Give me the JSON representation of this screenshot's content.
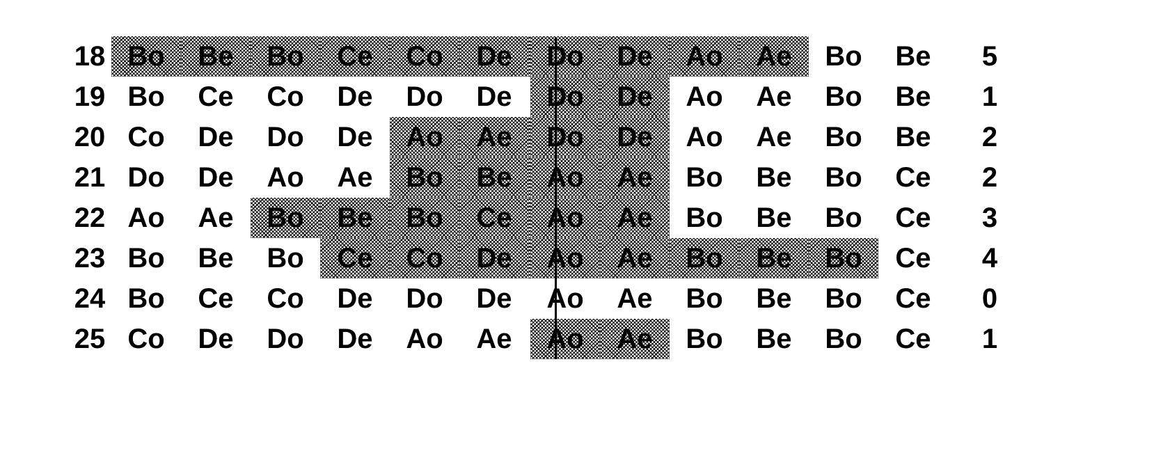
{
  "figure": {
    "type": "table",
    "description": "Genotype sequence table with shaded (halftone) highlighted blocks and a vertical separator between column 6 and column 7",
    "divider_after_column_index": 6,
    "columns": 12,
    "rows": 8
  },
  "table": {
    "row_label_header": "",
    "count_header": "",
    "rows": [
      {
        "number": "18",
        "cells": [
          "Bo",
          "Be",
          "Bo",
          "Ce",
          "Co",
          "De",
          "Do",
          "De",
          "Ao",
          "Ae",
          "Bo",
          "Be"
        ],
        "highlighted": [
          true,
          true,
          true,
          true,
          true,
          true,
          true,
          true,
          true,
          true,
          false,
          false
        ],
        "count": "5"
      },
      {
        "number": "19",
        "cells": [
          "Bo",
          "Ce",
          "Co",
          "De",
          "Do",
          "De",
          "Do",
          "De",
          "Ao",
          "Ae",
          "Bo",
          "Be"
        ],
        "highlighted": [
          false,
          false,
          false,
          false,
          false,
          false,
          true,
          true,
          false,
          false,
          false,
          false
        ],
        "count": "1"
      },
      {
        "number": "20",
        "cells": [
          "Co",
          "De",
          "Do",
          "De",
          "Ao",
          "Ae",
          "Do",
          "De",
          "Ao",
          "Ae",
          "Bo",
          "Be"
        ],
        "highlighted": [
          false,
          false,
          false,
          false,
          true,
          true,
          true,
          true,
          false,
          false,
          false,
          false
        ],
        "count": "2"
      },
      {
        "number": "21",
        "cells": [
          "Do",
          "De",
          "Ao",
          "Ae",
          "Bo",
          "Be",
          "Ao",
          "Ae",
          "Bo",
          "Be",
          "Bo",
          "Ce"
        ],
        "highlighted": [
          false,
          false,
          false,
          false,
          true,
          true,
          true,
          true,
          false,
          false,
          false,
          false
        ],
        "count": "2"
      },
      {
        "number": "22",
        "cells": [
          "Ao",
          "Ae",
          "Bo",
          "Be",
          "Bo",
          "Ce",
          "Ao",
          "Ae",
          "Bo",
          "Be",
          "Bo",
          "Ce"
        ],
        "highlighted": [
          false,
          false,
          true,
          true,
          true,
          true,
          true,
          true,
          false,
          false,
          false,
          false
        ],
        "count": "3"
      },
      {
        "number": "23",
        "cells": [
          "Bo",
          "Be",
          "Bo",
          "Ce",
          "Co",
          "De",
          "Ao",
          "Ae",
          "Bo",
          "Be",
          "Bo",
          "Ce"
        ],
        "highlighted": [
          false,
          false,
          false,
          true,
          true,
          true,
          true,
          true,
          true,
          true,
          true,
          false
        ],
        "count": "4"
      },
      {
        "number": "24",
        "cells": [
          "Bo",
          "Ce",
          "Co",
          "De",
          "Do",
          "De",
          "Ao",
          "Ae",
          "Bo",
          "Be",
          "Bo",
          "Ce"
        ],
        "highlighted": [
          false,
          false,
          false,
          false,
          false,
          false,
          false,
          false,
          false,
          false,
          false,
          false
        ],
        "count": "0"
      },
      {
        "number": "25",
        "cells": [
          "Co",
          "De",
          "Do",
          "De",
          "Ao",
          "Ae",
          "Ao",
          "Ae",
          "Bo",
          "Be",
          "Bo",
          "Ce"
        ],
        "highlighted": [
          false,
          false,
          false,
          false,
          false,
          false,
          true,
          true,
          false,
          false,
          false,
          false
        ],
        "count": "1"
      }
    ]
  },
  "colors": {
    "text": "#000000",
    "background": "#ffffff",
    "shade": "#000000",
    "divider": "#000000"
  }
}
